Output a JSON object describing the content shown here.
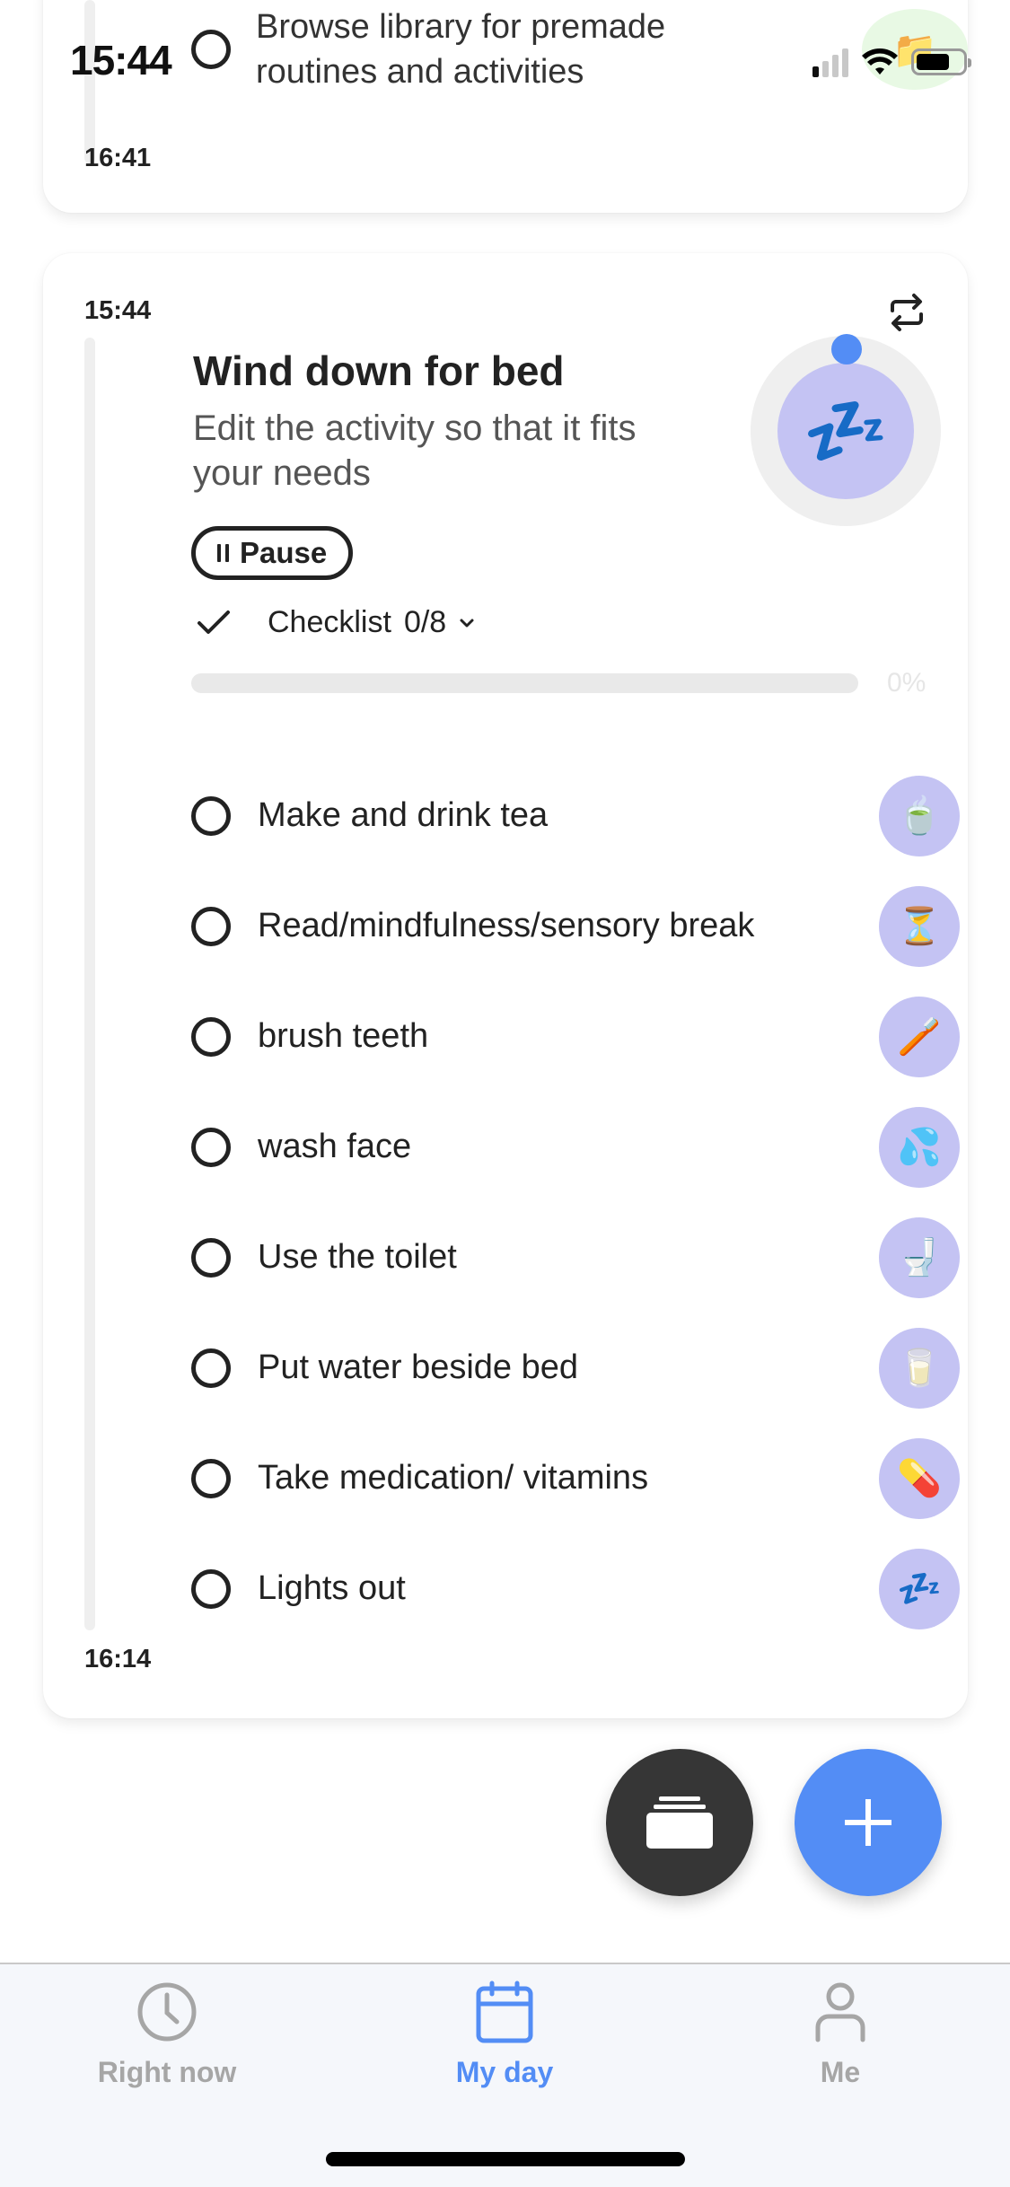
{
  "status_bar": {
    "time": "15:44",
    "signal_bars_active": 1,
    "signal_bars_total": 4,
    "battery_level": 0.72
  },
  "top_card": {
    "item_text": "Browse library for premade routines and activities",
    "item_icon": "folder-icon",
    "item_icon_glyph": "📁",
    "end_time": "16:41"
  },
  "activity": {
    "start_time": "15:44",
    "end_time": "16:14",
    "title": "Wind down for bed",
    "description": "Edit the activity so that it fits your needs",
    "pause_label": "Pause",
    "timer_icon_glyph": "💤",
    "checklist": {
      "label": "Checklist",
      "count": "0/8",
      "progress": 0,
      "progress_label": "0%",
      "items": [
        {
          "text": "Make and drink tea",
          "icon": "tea-icon",
          "glyph": "🍵",
          "done": false
        },
        {
          "text": "Read/mindfulness/sensory break",
          "icon": "sensory-timer-icon",
          "glyph": "⏳",
          "done": false
        },
        {
          "text": "brush teeth",
          "icon": "toothbrush-icon",
          "glyph": "🪥",
          "done": false
        },
        {
          "text": "wash face",
          "icon": "water-drops-icon",
          "glyph": "💦",
          "done": false
        },
        {
          "text": "Use the toilet",
          "icon": "toilet-icon",
          "glyph": "🚽",
          "done": false
        },
        {
          "text": "Put water beside bed",
          "icon": "water-glass-icon",
          "glyph": "🥛",
          "done": false
        },
        {
          "text": "Take medication/ vitamins",
          "icon": "pill-icon",
          "glyph": "💊",
          "done": false
        },
        {
          "text": "Lights out",
          "icon": "sleep-icon",
          "glyph": "💤",
          "done": false
        }
      ]
    }
  },
  "fabs": {
    "library": "library-icon",
    "add": "plus-icon"
  },
  "tab_bar": {
    "active": "my_day",
    "active_color": "#538df5",
    "inactive_color": "#a6a6a6",
    "tabs": [
      {
        "id": "right_now",
        "label": "Right now",
        "icon": "clock-icon"
      },
      {
        "id": "my_day",
        "label": "My day",
        "icon": "calendar-icon"
      },
      {
        "id": "me",
        "label": "Me",
        "icon": "person-icon"
      }
    ]
  },
  "colors": {
    "accent": "#538df5",
    "icon_bg": "#c4c3f3",
    "timeline": "#efefef",
    "fab_dark": "#363636"
  }
}
